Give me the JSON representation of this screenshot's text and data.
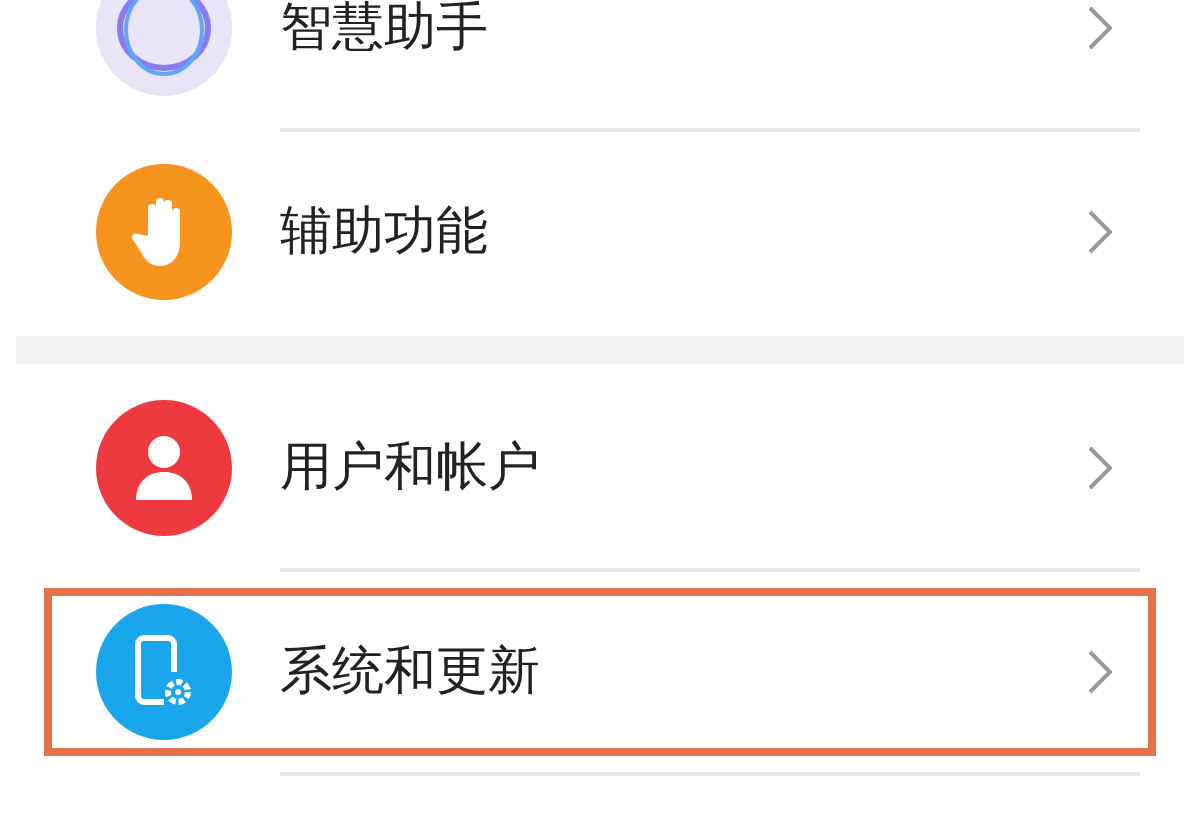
{
  "groups": [
    {
      "items": [
        {
          "label": "智慧助手",
          "color": "#e9e4f7",
          "highlighted": false
        },
        {
          "label": "辅助功能",
          "color": "#f7941d",
          "highlighted": false
        }
      ]
    },
    {
      "items": [
        {
          "label": "用户和帐户",
          "color": "#ee3a3f",
          "highlighted": false
        },
        {
          "label": "系统和更新",
          "color": "#1aa6ec",
          "highlighted": true
        }
      ]
    }
  ]
}
